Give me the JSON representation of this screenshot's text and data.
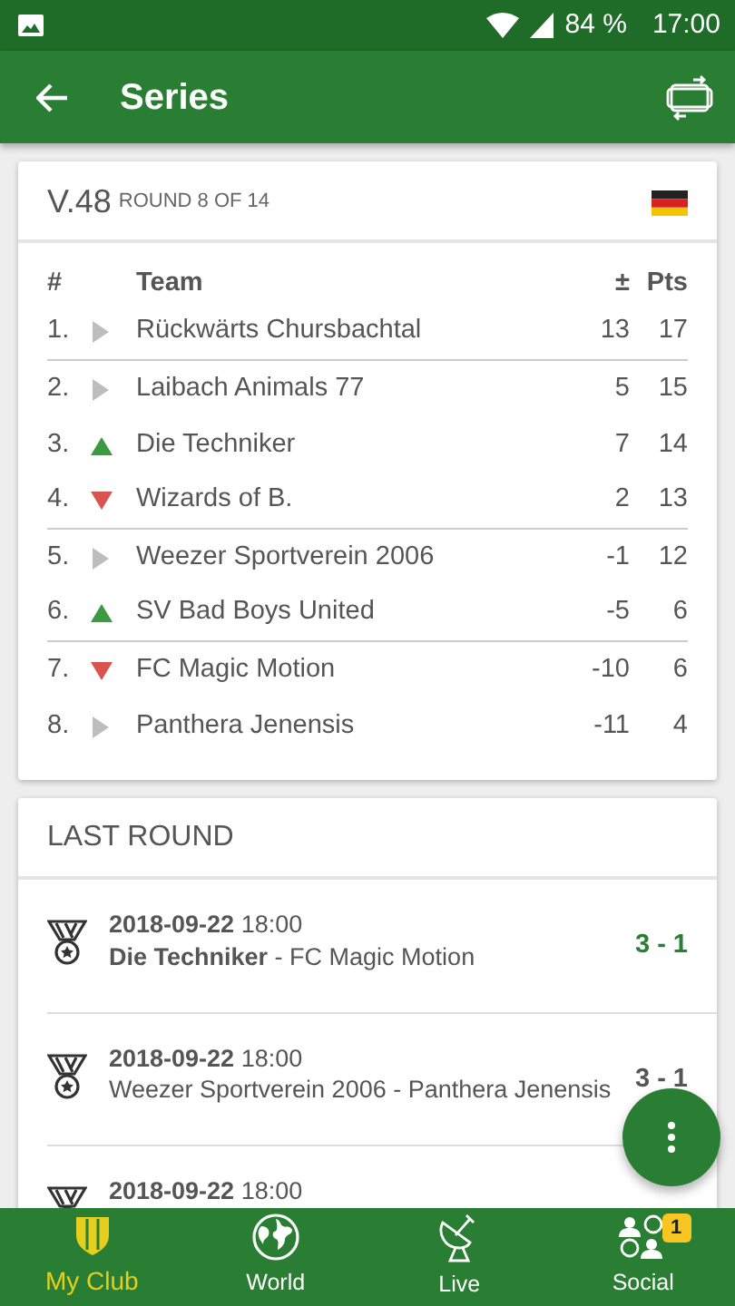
{
  "status_bar": {
    "battery": "84 %",
    "time": "17:00"
  },
  "app_bar": {
    "title": "Series"
  },
  "series": {
    "name": "V.48",
    "round": "ROUND 8 OF 14",
    "columns": {
      "rank": "#",
      "team": "Team",
      "diff": "±",
      "points": "Pts"
    },
    "rows": [
      {
        "rank": "1.",
        "kind": "same",
        "team": "Rückwärts Chursbachtal",
        "diff": "13",
        "points": "17",
        "line_below": true
      },
      {
        "rank": "2.",
        "kind": "same",
        "team": "Laibach Animals 77",
        "diff": "5",
        "points": "15",
        "line_below": false
      },
      {
        "rank": "3.",
        "kind": "up",
        "team": "Die Techniker",
        "diff": "7",
        "points": "14",
        "line_below": false
      },
      {
        "rank": "4.",
        "kind": "down",
        "team": "Wizards of B.",
        "diff": "2",
        "points": "13",
        "line_below": true
      },
      {
        "rank": "5.",
        "kind": "same",
        "team": "Weezer Sportverein 2006",
        "diff": "-1",
        "points": "12",
        "line_below": false
      },
      {
        "rank": "6.",
        "kind": "up",
        "team": "SV Bad Boys United",
        "diff": "-5",
        "points": "6",
        "line_below": true
      },
      {
        "rank": "7.",
        "kind": "down",
        "team": "FC Magic Motion",
        "diff": "-10",
        "points": "6",
        "line_below": false
      },
      {
        "rank": "8.",
        "kind": "same",
        "team": "Panthera Jenensis",
        "diff": "-11",
        "points": "4",
        "line_below": false
      }
    ]
  },
  "last_round": {
    "title": "LAST ROUND",
    "matches": [
      {
        "date": "2018-09-22",
        "time": "18:00",
        "teams": "**Die Techniker** - FC Magic Motion",
        "score": "3 - 1",
        "score_highlight": true
      },
      {
        "date": "2018-09-22",
        "time": "18:00",
        "teams": "Weezer Sportverein 2006 - Panthera Jenensis",
        "score": "3 - 1",
        "score_highlight": false
      },
      {
        "date": "2018-09-22",
        "time": "18:00"
      }
    ]
  },
  "bottom_nav": [
    {
      "kind": "club",
      "label": "My Club",
      "selected": true
    },
    {
      "kind": "world",
      "label": "World",
      "selected": false
    },
    {
      "kind": "live",
      "label": "Live",
      "selected": false
    },
    {
      "kind": "social",
      "label": "Social",
      "selected": false,
      "badge": "1"
    }
  ]
}
